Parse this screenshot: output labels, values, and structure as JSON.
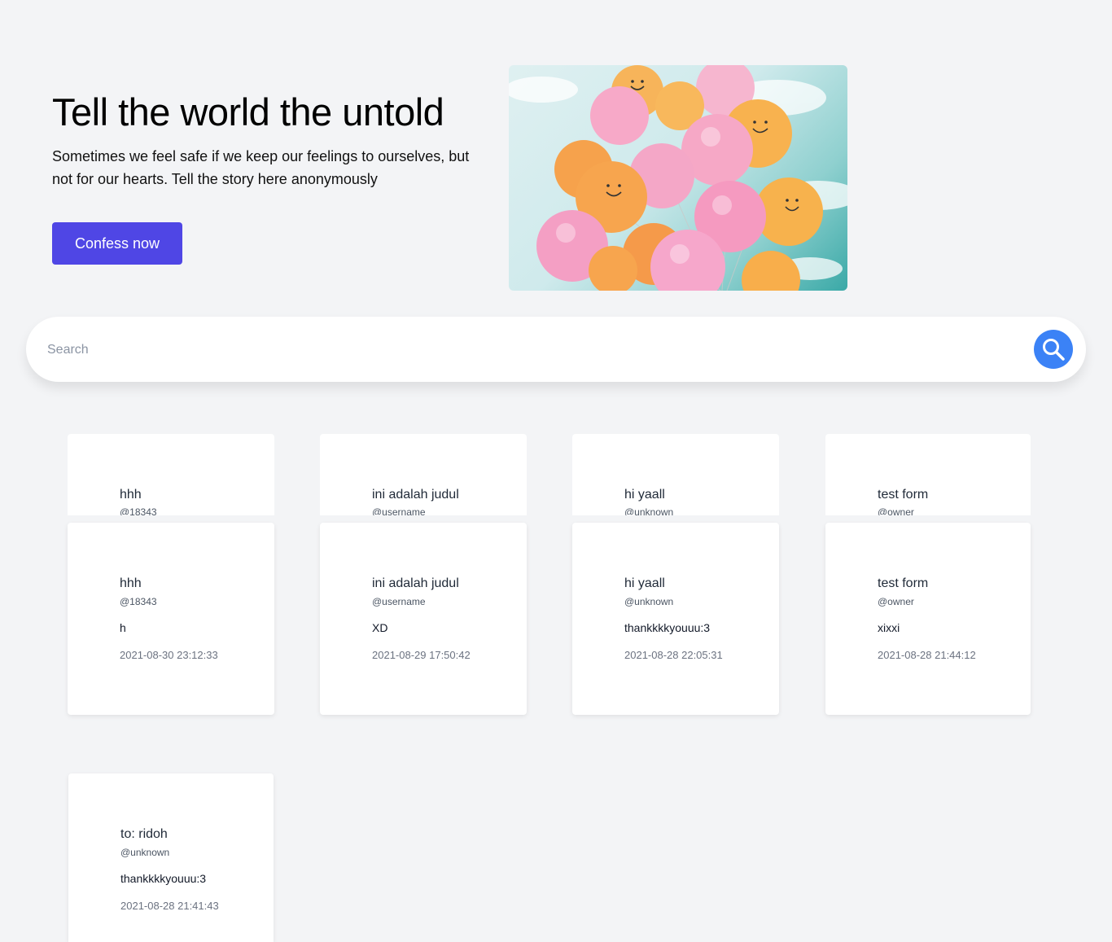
{
  "hero": {
    "title": "Tell the world the untold",
    "subtitle": "Sometimes we feel safe if we keep our feelings to ourselves, but not for our hearts. Tell the story here anonymously",
    "cta_label": "Confess now"
  },
  "search": {
    "placeholder": "Search"
  },
  "peek_cards": [
    {
      "title": "hhh",
      "username": "@18343"
    },
    {
      "title": "ini adalah judul",
      "username": "@username"
    },
    {
      "title": "hi yaall",
      "username": "@unknown"
    },
    {
      "title": "test form",
      "username": "@owner"
    }
  ],
  "cards": [
    {
      "title": "hhh",
      "username": "@18343",
      "body": "h",
      "date": "2021-08-30 23:12:33"
    },
    {
      "title": "ini adalah judul",
      "username": "@username",
      "body": "XD",
      "date": "2021-08-29 17:50:42"
    },
    {
      "title": "hi yaall",
      "username": "@unknown",
      "body": "thankkkkyouuu:3",
      "date": "2021-08-28 22:05:31"
    },
    {
      "title": "test form",
      "username": "@owner",
      "body": "xixxi",
      "date": "2021-08-28 21:44:12"
    },
    {
      "title": "to: ridoh",
      "username": "@unknown",
      "body": "thankkkkyouuu:3",
      "date": "2021-08-28 21:41:43"
    }
  ],
  "colors": {
    "accent": "#4f46e5",
    "search_button": "#3b82f6",
    "background": "#f3f4f6"
  }
}
